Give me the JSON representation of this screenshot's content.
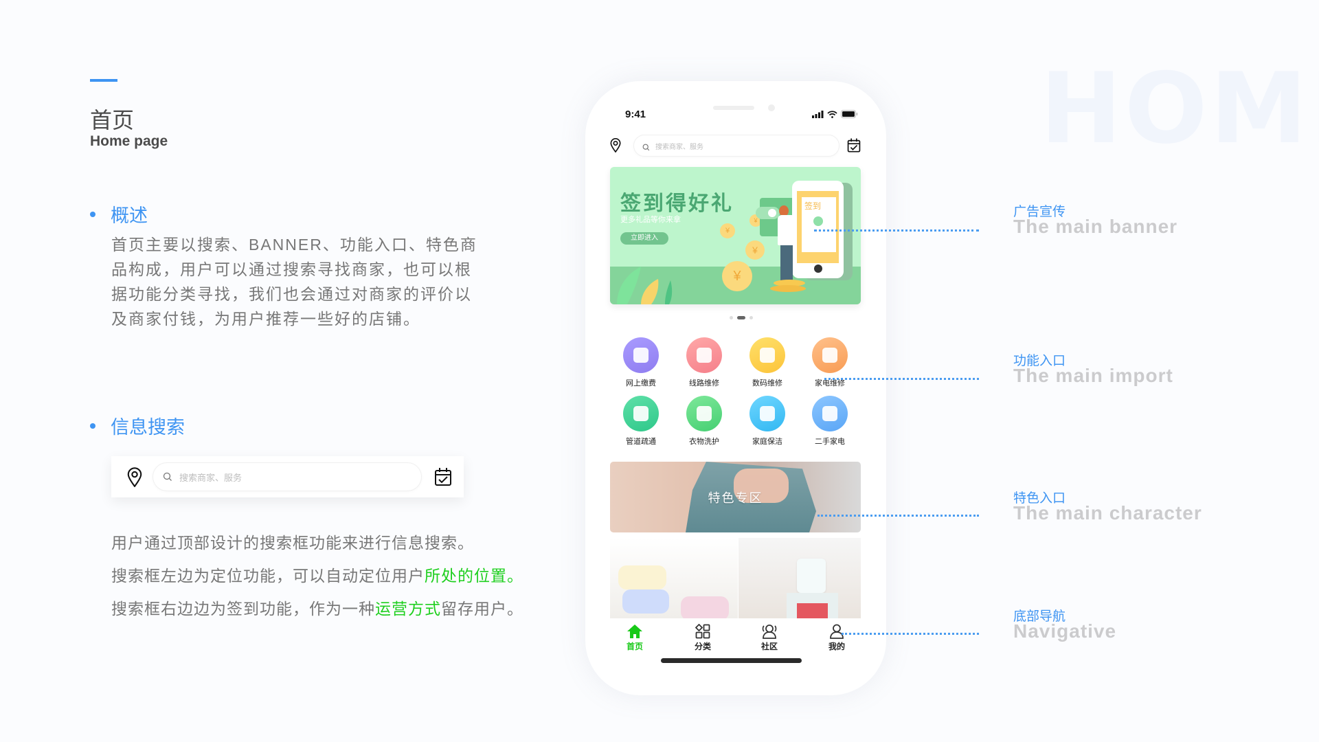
{
  "watermark": "HOME",
  "page": {
    "title_cn": "首页",
    "title_en": "Home page"
  },
  "overview": {
    "heading": "概述",
    "body": "首页主要以搜索、BANNER、功能入口、特色商品构成，用户可以通过搜索寻找商家，也可以根据功能分类寻找，我们也会通过对商家的评价以及商家付钱，为用户推荐一些好的店铺。"
  },
  "search_section": {
    "heading": "信息搜索",
    "search_placeholder": "搜索商家、服务",
    "lines": [
      {
        "parts": [
          {
            "text": "用户通过顶部设计的搜索框功能来进行信息搜索。",
            "highlight": false
          }
        ]
      },
      {
        "parts": [
          {
            "text": "搜索框左边为定位功能，可以自动定位用户",
            "highlight": false
          },
          {
            "text": "所处的位置。",
            "highlight": true
          }
        ]
      },
      {
        "parts": [
          {
            "text": "搜索框右边边为签到功能，作为一种",
            "highlight": false
          },
          {
            "text": "运营方式",
            "highlight": true
          },
          {
            "text": "留存用户。",
            "highlight": false
          }
        ]
      }
    ]
  },
  "phone": {
    "status_time": "9:41",
    "search_placeholder": "搜索商家、服务",
    "banner": {
      "title": "签到得好礼",
      "subtitle": "更多礼品等你来拿",
      "button": "立即进入",
      "phone_label": "签到",
      "currency_symbol": "¥",
      "dots": 3,
      "active_dot": 1
    },
    "functions": [
      {
        "label": "网上缴费",
        "icon": "payment-hand-icon",
        "color1": "#a99bff",
        "color2": "#8f7df0"
      },
      {
        "label": "线路维修",
        "icon": "map-pin-icon",
        "color1": "#ffa8a8",
        "color2": "#f57f8a"
      },
      {
        "label": "数码维修",
        "icon": "gamepad-icon",
        "color1": "#ffe06a",
        "color2": "#fcc43a"
      },
      {
        "label": "家电维修",
        "icon": "fan-icon",
        "color1": "#ffc08a",
        "color2": "#f89c55"
      },
      {
        "label": "管道疏通",
        "icon": "pipe-icon",
        "color1": "#5ee0a8",
        "color2": "#2fc88a"
      },
      {
        "label": "衣物洗护",
        "icon": "tshirt-icon",
        "color1": "#7ee89a",
        "color2": "#45cf72"
      },
      {
        "label": "家庭保洁",
        "icon": "trash-bin-icon",
        "color1": "#6fd6ff",
        "color2": "#32b8f2"
      },
      {
        "label": "二手家电",
        "icon": "recycle-bin-icon",
        "color1": "#8cc6ff",
        "color2": "#5aa6f6"
      }
    ],
    "feature_banner": {
      "label": "特色专区"
    },
    "tabs": [
      {
        "label": "首页",
        "icon": "home-icon",
        "active": true
      },
      {
        "label": "分类",
        "icon": "category-icon",
        "active": false
      },
      {
        "label": "社区",
        "icon": "community-icon",
        "active": false
      },
      {
        "label": "我的",
        "icon": "profile-icon",
        "active": false
      }
    ]
  },
  "annotations": [
    {
      "cn": "广告宣传",
      "en": "The main banner"
    },
    {
      "cn": "功能入口",
      "en": "The main import"
    },
    {
      "cn": "特色入口",
      "en": "The main character"
    },
    {
      "cn": "底部导航",
      "en": "Navigative"
    }
  ],
  "colors": {
    "accent_blue": "#3e94f2",
    "highlight_green": "#1ecf1e",
    "tab_active": "#18c918"
  }
}
